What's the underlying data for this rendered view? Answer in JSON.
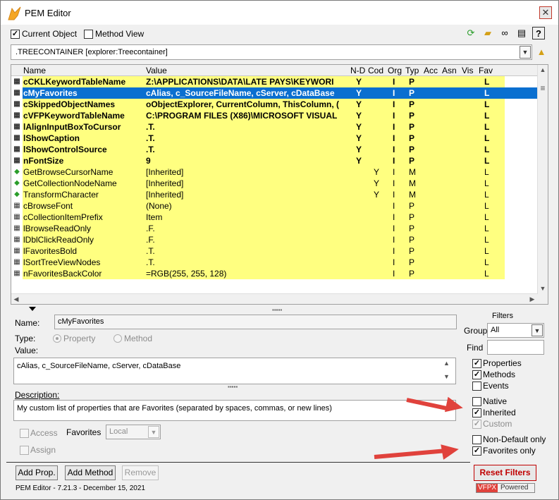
{
  "window": {
    "title": "PEM Editor",
    "close": "✕"
  },
  "toolbar": {
    "current_object": "Current Object",
    "method_view": "Method View",
    "icons": [
      "refresh-icon",
      "open-folder-icon",
      "binoculars-icon",
      "properties-icon",
      "help-icon"
    ]
  },
  "object_combo": {
    "value": ".TREECONTAINER [explorer:Treecontainer]"
  },
  "grid": {
    "headers": [
      "Name",
      "Value",
      "N-D",
      "Cod",
      "Org",
      "Typ",
      "Acc",
      "Asn",
      "Vis",
      "Fav"
    ],
    "rows": [
      {
        "name": "cCKLKeywordTableName",
        "value": "Z:\\APPLICATIONS\\DATA\\LATE PAYS\\KEYWORI",
        "nd": "Y",
        "cod": "",
        "org": "I",
        "typ": "P",
        "acc": "",
        "asn": "",
        "vis": "",
        "fav": "L",
        "bold": true,
        "style": "yel",
        "icon": "property-icon"
      },
      {
        "name": "cMyFavorites",
        "value": "cAlias, c_SourceFileName, cServer, cDataBase",
        "nd": "Y",
        "cod": "",
        "org": "I",
        "typ": "P",
        "acc": "",
        "asn": "",
        "vis": "",
        "fav": "L",
        "bold": true,
        "style": "sel",
        "icon": "property-icon"
      },
      {
        "name": "cSkippedObjectNames",
        "value": "oObjectExplorer, CurrentColumn, ThisColumn, (",
        "nd": "Y",
        "cod": "",
        "org": "I",
        "typ": "P",
        "acc": "",
        "asn": "",
        "vis": "",
        "fav": "L",
        "bold": true,
        "style": "yel",
        "icon": "property-icon"
      },
      {
        "name": "cVFPKeywordTableName",
        "value": "C:\\PROGRAM FILES (X86)\\MICROSOFT VISUAL",
        "nd": "Y",
        "cod": "",
        "org": "I",
        "typ": "P",
        "acc": "",
        "asn": "",
        "vis": "",
        "fav": "L",
        "bold": true,
        "style": "yel",
        "icon": "property-icon"
      },
      {
        "name": "lAlignInputBoxToCursor",
        "value": ".T.",
        "nd": "Y",
        "cod": "",
        "org": "I",
        "typ": "P",
        "acc": "",
        "asn": "",
        "vis": "",
        "fav": "L",
        "bold": true,
        "style": "yel",
        "icon": "property-icon"
      },
      {
        "name": "lShowCaption",
        "value": ".T.",
        "nd": "Y",
        "cod": "",
        "org": "I",
        "typ": "P",
        "acc": "",
        "asn": "",
        "vis": "",
        "fav": "L",
        "bold": true,
        "style": "yel",
        "icon": "property-icon"
      },
      {
        "name": "lShowControlSource",
        "value": ".T.",
        "nd": "Y",
        "cod": "",
        "org": "I",
        "typ": "P",
        "acc": "",
        "asn": "",
        "vis": "",
        "fav": "L",
        "bold": true,
        "style": "yel",
        "icon": "property-icon"
      },
      {
        "name": "nFontSize",
        "value": "9",
        "nd": "Y",
        "cod": "",
        "org": "I",
        "typ": "P",
        "acc": "",
        "asn": "",
        "vis": "",
        "fav": "L",
        "bold": true,
        "style": "yel",
        "icon": "property-icon"
      },
      {
        "name": "GetBrowseCursorName",
        "value": "[Inherited]",
        "nd": "",
        "cod": "Y",
        "org": "I",
        "typ": "M",
        "acc": "",
        "asn": "",
        "vis": "",
        "fav": "L",
        "bold": false,
        "style": "yel",
        "icon": "method-icon"
      },
      {
        "name": "GetCollectionNodeName",
        "value": "[Inherited]",
        "nd": "",
        "cod": "Y",
        "org": "I",
        "typ": "M",
        "acc": "",
        "asn": "",
        "vis": "",
        "fav": "L",
        "bold": false,
        "style": "yel",
        "icon": "method-icon"
      },
      {
        "name": "TransformCharacter",
        "value": "[Inherited]",
        "nd": "",
        "cod": "Y",
        "org": "I",
        "typ": "M",
        "acc": "",
        "asn": "",
        "vis": "",
        "fav": "L",
        "bold": false,
        "style": "yel",
        "icon": "method-icon"
      },
      {
        "name": "cBrowseFont",
        "value": "(None)",
        "nd": "",
        "cod": "",
        "org": "I",
        "typ": "P",
        "acc": "",
        "asn": "",
        "vis": "",
        "fav": "L",
        "bold": false,
        "style": "yel",
        "icon": "property-icon"
      },
      {
        "name": "cCollectionItemPrefix",
        "value": "Item",
        "nd": "",
        "cod": "",
        "org": "I",
        "typ": "P",
        "acc": "",
        "asn": "",
        "vis": "",
        "fav": "L",
        "bold": false,
        "style": "yel",
        "icon": "property-icon"
      },
      {
        "name": "lBrowseReadOnly",
        "value": ".F.",
        "nd": "",
        "cod": "",
        "org": "I",
        "typ": "P",
        "acc": "",
        "asn": "",
        "vis": "",
        "fav": "L",
        "bold": false,
        "style": "yel",
        "icon": "property-icon"
      },
      {
        "name": "lDblClickReadOnly",
        "value": ".F.",
        "nd": "",
        "cod": "",
        "org": "I",
        "typ": "P",
        "acc": "",
        "asn": "",
        "vis": "",
        "fav": "L",
        "bold": false,
        "style": "yel",
        "icon": "property-icon"
      },
      {
        "name": "lFavoritesBold",
        "value": ".T.",
        "nd": "",
        "cod": "",
        "org": "I",
        "typ": "P",
        "acc": "",
        "asn": "",
        "vis": "",
        "fav": "L",
        "bold": false,
        "style": "yel",
        "icon": "property-icon"
      },
      {
        "name": "lSortTreeViewNodes",
        "value": ".T.",
        "nd": "",
        "cod": "",
        "org": "I",
        "typ": "P",
        "acc": "",
        "asn": "",
        "vis": "",
        "fav": "L",
        "bold": false,
        "style": "yel",
        "icon": "property-icon"
      },
      {
        "name": "nFavoritesBackColor",
        "value": "=RGB(255, 255, 128)",
        "nd": "",
        "cod": "",
        "org": "I",
        "typ": "P",
        "acc": "",
        "asn": "",
        "vis": "",
        "fav": "L",
        "bold": false,
        "style": "yel",
        "icon": "property-icon"
      }
    ]
  },
  "details": {
    "name_label": "Name:",
    "name_value": "cMyFavorites",
    "type_label": "Type:",
    "type_property": "Property",
    "type_method": "Method",
    "value_label": "Value:",
    "value_text": "cAlias, c_SourceFileName, cServer, cDataBase",
    "description_label": "Description:",
    "description_text": "My custom list of properties that are Favorites (separated by spaces, commas, or new lines)",
    "access": "Access",
    "assign": "Assign",
    "favorites_label": "Favorites",
    "favorites_value": "Local"
  },
  "filters": {
    "title": "Filters",
    "group_label": "Group",
    "group_value": "All",
    "find_label": "Find",
    "find_value": "",
    "properties": "Properties",
    "methods": "Methods",
    "events": "Events",
    "native": "Native",
    "inherited": "Inherited",
    "custom": "Custom",
    "non_default_only": "Non-Default only",
    "favorites_only": "Favorites only",
    "reset": "Reset Filters"
  },
  "buttons": {
    "add_prop": "Add Prop.",
    "add_method": "Add Method",
    "remove": "Remove"
  },
  "footer": {
    "version": "PEM Editor - 7.21.3 - December 15, 2021",
    "vfpx": "VFPX",
    "powered": "Powered"
  },
  "colors": {
    "favorite_bg": "#ffff80",
    "selection": "#0a6fd0",
    "reset_text": "#c00000",
    "arrow": "#e0423c"
  }
}
